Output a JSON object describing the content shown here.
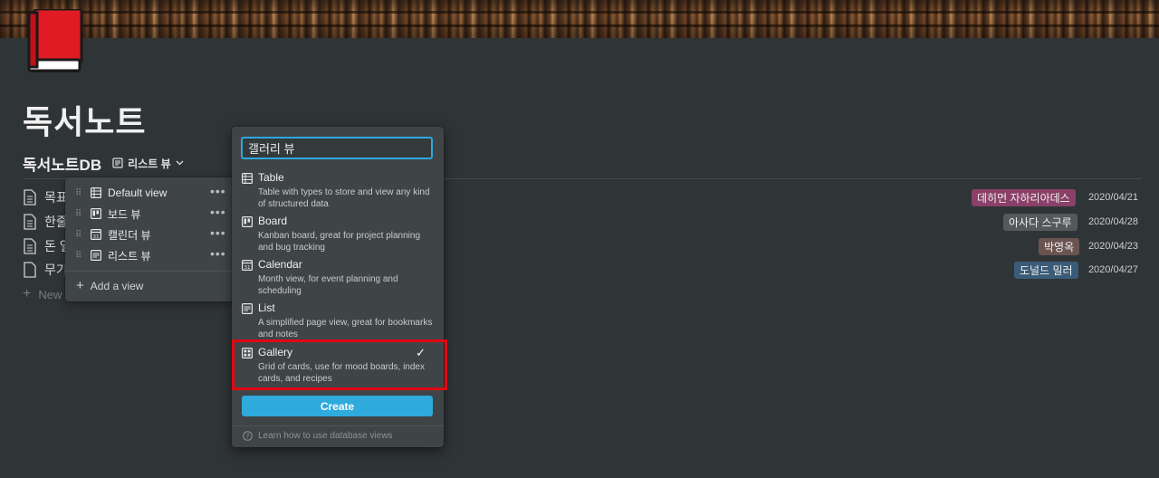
{
  "page": {
    "title": "독서노트"
  },
  "database": {
    "title": "독서노트DB",
    "current_view": "리스트 뷰"
  },
  "rows": [
    {
      "title": "목표",
      "tag": "데히먼 자하리아데스",
      "tag_color": "#8a4068",
      "date": "2020/04/21"
    },
    {
      "title": "한줄",
      "tag": "아사다 스구루",
      "tag_color": "#55595c",
      "date": "2020/04/28"
    },
    {
      "title": "돈 일",
      "tag": "박영옥",
      "tag_color": "#6b5450",
      "date": "2020/04/23"
    },
    {
      "title": "무기",
      "tag": "도널드 밀러",
      "tag_color": "#3b5c78",
      "date": "2020/04/27"
    }
  ],
  "new_row_label": "New",
  "views_menu": {
    "items": [
      {
        "label": "Default view",
        "icon": "table-icon"
      },
      {
        "label": "보드 뷰",
        "icon": "board-icon"
      },
      {
        "label": "캘린더 뷰",
        "icon": "calendar-icon"
      },
      {
        "label": "리스트 뷰",
        "icon": "list-icon"
      }
    ],
    "add_label": "Add a view",
    "more_glyph": "•••"
  },
  "new_view_popup": {
    "input_value": "갤러리 뷰",
    "options": [
      {
        "name": "Table",
        "desc": "Table with types to store and view any kind of structured data",
        "icon": "table-icon"
      },
      {
        "name": "Board",
        "desc": "Kanban board, great for project planning and bug tracking",
        "icon": "board-icon"
      },
      {
        "name": "Calendar",
        "desc": "Month view, for event planning and scheduling",
        "icon": "calendar-icon"
      },
      {
        "name": "List",
        "desc": "A simplified page view, great for bookmarks and notes",
        "icon": "list-icon"
      },
      {
        "name": "Gallery",
        "desc": "Grid of cards, use for mood boards, index cards, and recipes",
        "icon": "gallery-icon",
        "selected": true
      }
    ],
    "create_label": "Create",
    "help_text": "Learn how to use database views"
  },
  "colors": {
    "background": "#2f3437",
    "popup": "#3f4447",
    "accent": "#2eaadc",
    "highlight_box": "#e30613",
    "book_icon": "#d9141e"
  }
}
